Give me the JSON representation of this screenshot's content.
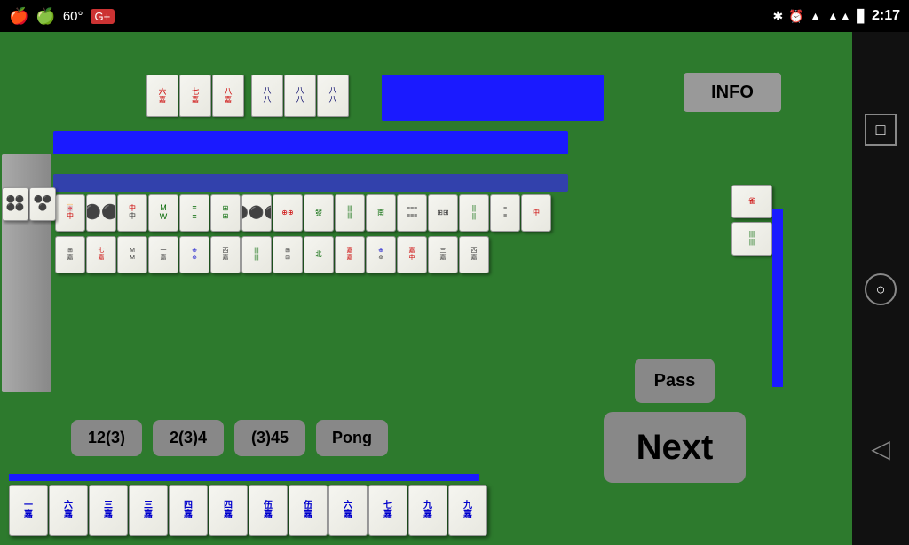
{
  "statusBar": {
    "apple1": "🍎",
    "apple2": "🍏",
    "temperature": "60°",
    "gplus": "G+",
    "time": "2:17",
    "bluetooth": "⚡",
    "alarm": "⏰",
    "signal": "▲",
    "battery": "🔋"
  },
  "buttons": {
    "info": "INFO",
    "action1": "12(3)",
    "action2": "2(3)4",
    "action3": "(3)45",
    "action4": "Pong",
    "pass": "Pass",
    "next": "Next"
  },
  "nav": {
    "square": "□",
    "circle": "○",
    "back": "◁"
  },
  "tiles": {
    "topGroup1": [
      "六嘉",
      "七嘉",
      "八嘉"
    ],
    "topGroup2": [
      "八八",
      "八八",
      "八八"
    ],
    "bottom": [
      "一嘉",
      "六嘉",
      "三嘉",
      "三嘉",
      "四嘉",
      "四嘉",
      "伍嘉",
      "伍嘉",
      "六嘉",
      "七嘉",
      "九嘉",
      "九嘉"
    ]
  }
}
